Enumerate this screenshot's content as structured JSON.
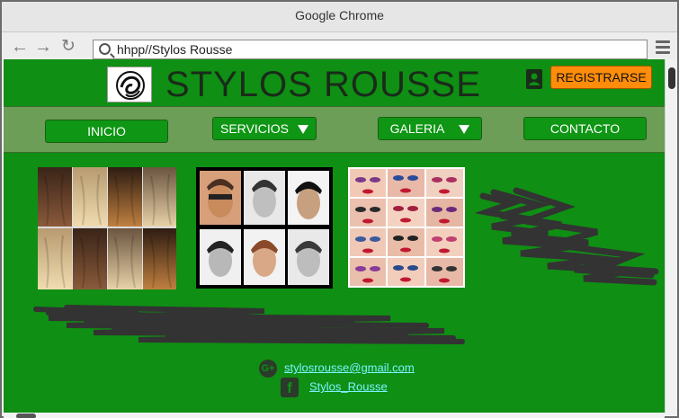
{
  "browser": {
    "window_title": "Google Chrome",
    "address": "hhpp//Stylos Rousse",
    "back_icon": "back-arrow-icon",
    "forward_icon": "forward-arrow-icon",
    "reload_icon": "reload-icon",
    "menu_icon": "hamburger-menu-icon"
  },
  "header": {
    "title": "STYLOS ROUSSE",
    "register_label": "REGISTRARSE",
    "register_color": "#ff8c0a"
  },
  "nav": {
    "items": [
      {
        "label": "INICIO",
        "dropdown": false
      },
      {
        "label": "SERVICIOS",
        "dropdown": true
      },
      {
        "label": "GALERIA",
        "dropdown": true
      },
      {
        "label": "CONTACTO",
        "dropdown": false
      }
    ]
  },
  "gallery": {
    "images": [
      {
        "subject": "hair color styles"
      },
      {
        "subject": "men haircuts"
      },
      {
        "subject": "makeup looks"
      }
    ]
  },
  "footer": {
    "email": "stylosrousse@gmail.com",
    "facebook": "Stylos_Rousse"
  },
  "colors": {
    "page_green": "#0f8f13",
    "nav_bar": "#6c9e57",
    "link": "#7cf2ff"
  }
}
